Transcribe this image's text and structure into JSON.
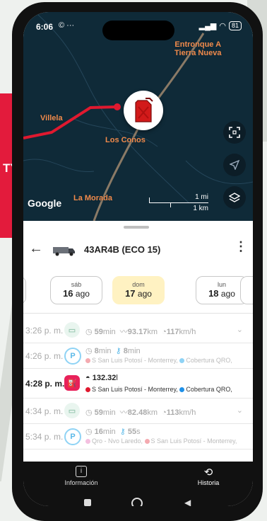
{
  "promo": {
    "text": "TY"
  },
  "status_bar": {
    "time": "6:06",
    "left_icons": "© ···",
    "battery": "81"
  },
  "map": {
    "labels": {
      "entronque_line1": "Entronque A",
      "entronque_line2": "Tierra Nueva",
      "villela": "Villela",
      "los_conos": "Los Conos",
      "la_morada": "La Morada"
    },
    "attribution": "Google",
    "scale": {
      "miles": "1 mi",
      "km": "1 km"
    },
    "marker_icon": "fuel-can-icon"
  },
  "header": {
    "vehicle": "43AR4B (ECO 15)"
  },
  "days": [
    {
      "name": "sáb",
      "day": "16",
      "month": "ago",
      "active": false
    },
    {
      "name": "dom",
      "day": "17",
      "month": "ago",
      "active": true
    },
    {
      "name": "lun",
      "day": "18",
      "month": "ago",
      "active": false
    }
  ],
  "events": {
    "r0": {
      "time": "3:26 p. m.",
      "duration": "59",
      "dur_unit": "min",
      "distance": "93.17",
      "dist_unit": "km",
      "speed": "117",
      "speed_unit": "km/h"
    },
    "r1": {
      "time": "4:26 p. m.",
      "duration": "8",
      "dur_unit": "min",
      "engine": "8",
      "engine_unit": "min",
      "from": "S San Luis Potosí - Monterrey,",
      "to": "Cobertura QRO,"
    },
    "r2": {
      "time": "4:28 p. m.",
      "fuel": "132.32",
      "fuel_unit": "l",
      "from": "S San Luis Potosí - Monterrey,",
      "to": "Cobertura QRO,"
    },
    "r3": {
      "time": "4:34 p. m.",
      "duration": "59",
      "dur_unit": "min",
      "distance": "82.48",
      "dist_unit": "km",
      "speed": "113",
      "speed_unit": "km/h"
    },
    "r4": {
      "time": "5:34 p. m.",
      "duration": "16",
      "dur_unit": "min",
      "engine": "55",
      "engine_unit": "s",
      "from": "Qro - Nvo Laredo,",
      "to": "S San Luis Potosí - Monterrey,"
    }
  },
  "bottom_nav": {
    "info": "Información",
    "history": "Historia"
  },
  "colors": {
    "accent_red": "#e31b3c",
    "map_bg": "#0f2a38",
    "map_label": "#f08a4b",
    "active_day": "#fff2c2",
    "fuel_badge": "#e8215a",
    "parking_blue": "#8fd3f5"
  }
}
